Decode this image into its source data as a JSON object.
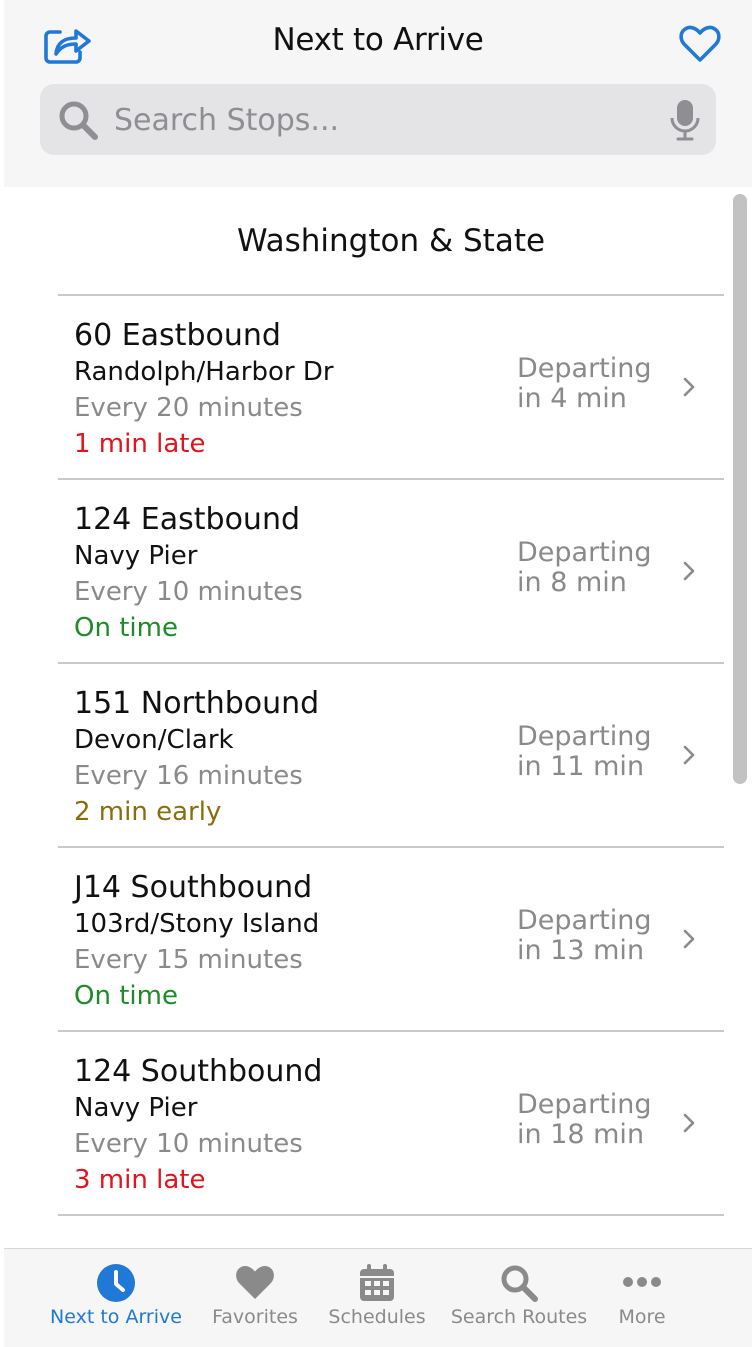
{
  "header": {
    "title": "Next to Arrive",
    "share_icon": "share-icon",
    "favorite_icon": "heart-outline-icon",
    "accent_color": "#2079d6"
  },
  "search": {
    "placeholder": "Search Stops...",
    "value": "",
    "icon": "search-icon",
    "mic_icon": "microphone-icon"
  },
  "stop": {
    "name": "Washington & State"
  },
  "arrivals": [
    {
      "route": "60 Eastbound",
      "destination": "Randolph/Harbor Dr",
      "frequency": "Every 20 minutes",
      "status": "1 min late",
      "status_type": "late",
      "departing_line1": "Departing",
      "departing_line2": "in 4 min"
    },
    {
      "route": "124 Eastbound",
      "destination": "Navy Pier",
      "frequency": "Every 10 minutes",
      "status": "On time",
      "status_type": "ontime",
      "departing_line1": "Departing",
      "departing_line2": "in 8 min"
    },
    {
      "route": "151 Northbound",
      "destination": "Devon/Clark",
      "frequency": "Every 16 minutes",
      "status": "2 min early",
      "status_type": "early",
      "departing_line1": "Departing",
      "departing_line2": "in 11 min"
    },
    {
      "route": "J14 Southbound",
      "destination": "103rd/Stony Island",
      "frequency": "Every 15 minutes",
      "status": "On time",
      "status_type": "ontime",
      "departing_line1": "Departing",
      "departing_line2": "in 13 min"
    },
    {
      "route": "124 Southbound",
      "destination": "Navy Pier",
      "frequency": "Every 10 minutes",
      "status": "3 min late",
      "status_type": "late",
      "departing_line1": "Departing",
      "departing_line2": "in 18 min"
    }
  ],
  "status_colors": {
    "late": "#e0141e",
    "ontime": "#1f8a2a",
    "early": "#8a6e0e"
  },
  "tabbar": {
    "tabs": [
      {
        "label": "Next to Arrive",
        "icon": "clock-icon",
        "active": true
      },
      {
        "label": "Favorites",
        "icon": "heart-icon",
        "active": false
      },
      {
        "label": "Schedules",
        "icon": "calendar-icon",
        "active": false
      },
      {
        "label": "Search Routes",
        "icon": "search-icon",
        "active": false
      },
      {
        "label": "More",
        "icon": "ellipsis-icon",
        "active": false
      }
    ]
  }
}
